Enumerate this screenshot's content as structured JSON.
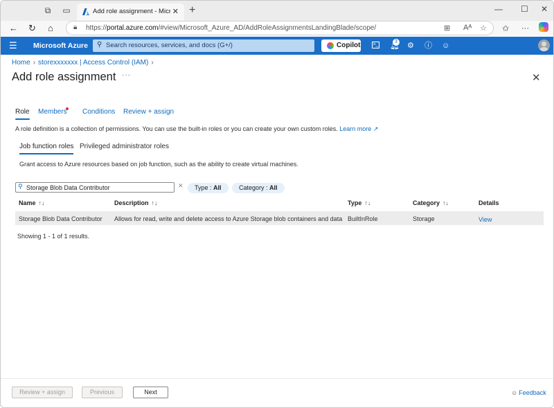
{
  "browser": {
    "tab_title": "Add role assignment - Microsoft Azure",
    "url_prefix": "https://",
    "url_domain": "portal.azure.com",
    "url_path": "/#view/Microsoft_Azure_AD/AddRoleAssignmentsLandingBlade/scope/",
    "new_tab_label": "+",
    "more_label": "···"
  },
  "header": {
    "brand": "Microsoft Azure",
    "search_placeholder": "Search resources, services, and docs (G+/)",
    "copilot_label": "Copilot",
    "notification_count": "3"
  },
  "breadcrumb": {
    "items": [
      "Home",
      "storexxxxxxx | Access Control (IAM)"
    ]
  },
  "page": {
    "title": "Add role assignment",
    "more_label": "···"
  },
  "tabs": [
    {
      "label": "Role",
      "active": true
    },
    {
      "label": "Members",
      "required": true
    },
    {
      "label": "Conditions"
    },
    {
      "label": "Review + assign"
    }
  ],
  "description": {
    "text": "A role definition is a collection of permissions. You can use the built-in roles or you can create your own custom roles.",
    "link": "Learn more"
  },
  "subtabs": [
    {
      "label": "Job function roles",
      "active": true
    },
    {
      "label": "Privileged administrator roles"
    }
  ],
  "grant_text": "Grant access to Azure resources based on job function, such as the ability to create virtual machines.",
  "filters": {
    "search_value": "Storage Blob Data Contributor",
    "type_label": "Type : ",
    "type_value": "All",
    "category_label": "Category : ",
    "category_value": "All"
  },
  "table": {
    "columns": [
      "Name",
      "Description",
      "Type",
      "Category",
      "Details"
    ],
    "rows": [
      {
        "name": "Storage Blob Data Contributor",
        "description": "Allows for read, write and delete access to Azure Storage blob containers and data",
        "type": "BuiltInRole",
        "category": "Storage",
        "details": "View"
      }
    ],
    "showing": "Showing 1 - 1 of 1 results."
  },
  "footer": {
    "review_assign": "Review + assign",
    "previous": "Previous",
    "next": "Next",
    "feedback": "Feedback"
  },
  "colors": {
    "azure_blue": "#1b6fc8",
    "link_blue": "#0f6cbd",
    "required_red": "#d13438"
  }
}
